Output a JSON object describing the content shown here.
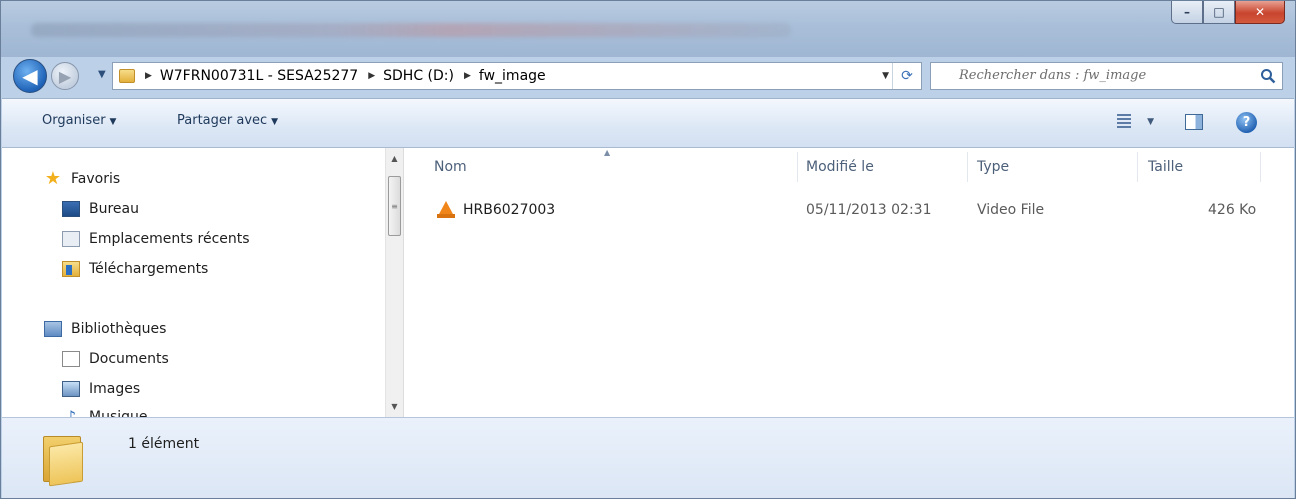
{
  "window": {
    "controls": {
      "minimize": "–",
      "maximize": "□",
      "close": "✕"
    }
  },
  "address_bar": {
    "back_glyph": "◀",
    "forward_glyph": "▶",
    "recent_glyph": "▼",
    "breadcrumbs": [
      "W7FRN00731L - SESA25277",
      "SDHC (D:)",
      "fw_image"
    ],
    "separator": "▶",
    "dropdown_glyph": "▼",
    "refresh_glyph": "⟳"
  },
  "search": {
    "placeholder": "Rechercher dans : fw_image"
  },
  "toolbar": {
    "organize_label": "Organiser",
    "share_label": "Partager avec",
    "caret": "▼",
    "help_glyph": "?"
  },
  "nav": {
    "favorites": {
      "label": "Favoris",
      "items": [
        "Bureau",
        "Emplacements récents",
        "Téléchargements"
      ]
    },
    "libraries": {
      "label": "Bibliothèques",
      "items": [
        "Documents",
        "Images",
        "Musique"
      ]
    },
    "scroll_up": "▲",
    "scroll_down": "▼",
    "thumb_grip": "≡"
  },
  "file_list": {
    "columns": {
      "name": "Nom",
      "modified": "Modifié le",
      "type": "Type",
      "size": "Taille"
    },
    "sort_indicator": "▲",
    "rows": [
      {
        "name": "HRB6027003",
        "modified": "05/11/2013 02:31",
        "type": "Video File",
        "size": "426 Ko",
        "icon": "vlc-cone-icon"
      }
    ]
  },
  "status": {
    "count": "1 élément"
  },
  "colors": {
    "frame": "#bcd0e8",
    "toolbar_text": "#1e395b",
    "header_text": "#4c607a",
    "vlc_orange": "#f08519"
  }
}
